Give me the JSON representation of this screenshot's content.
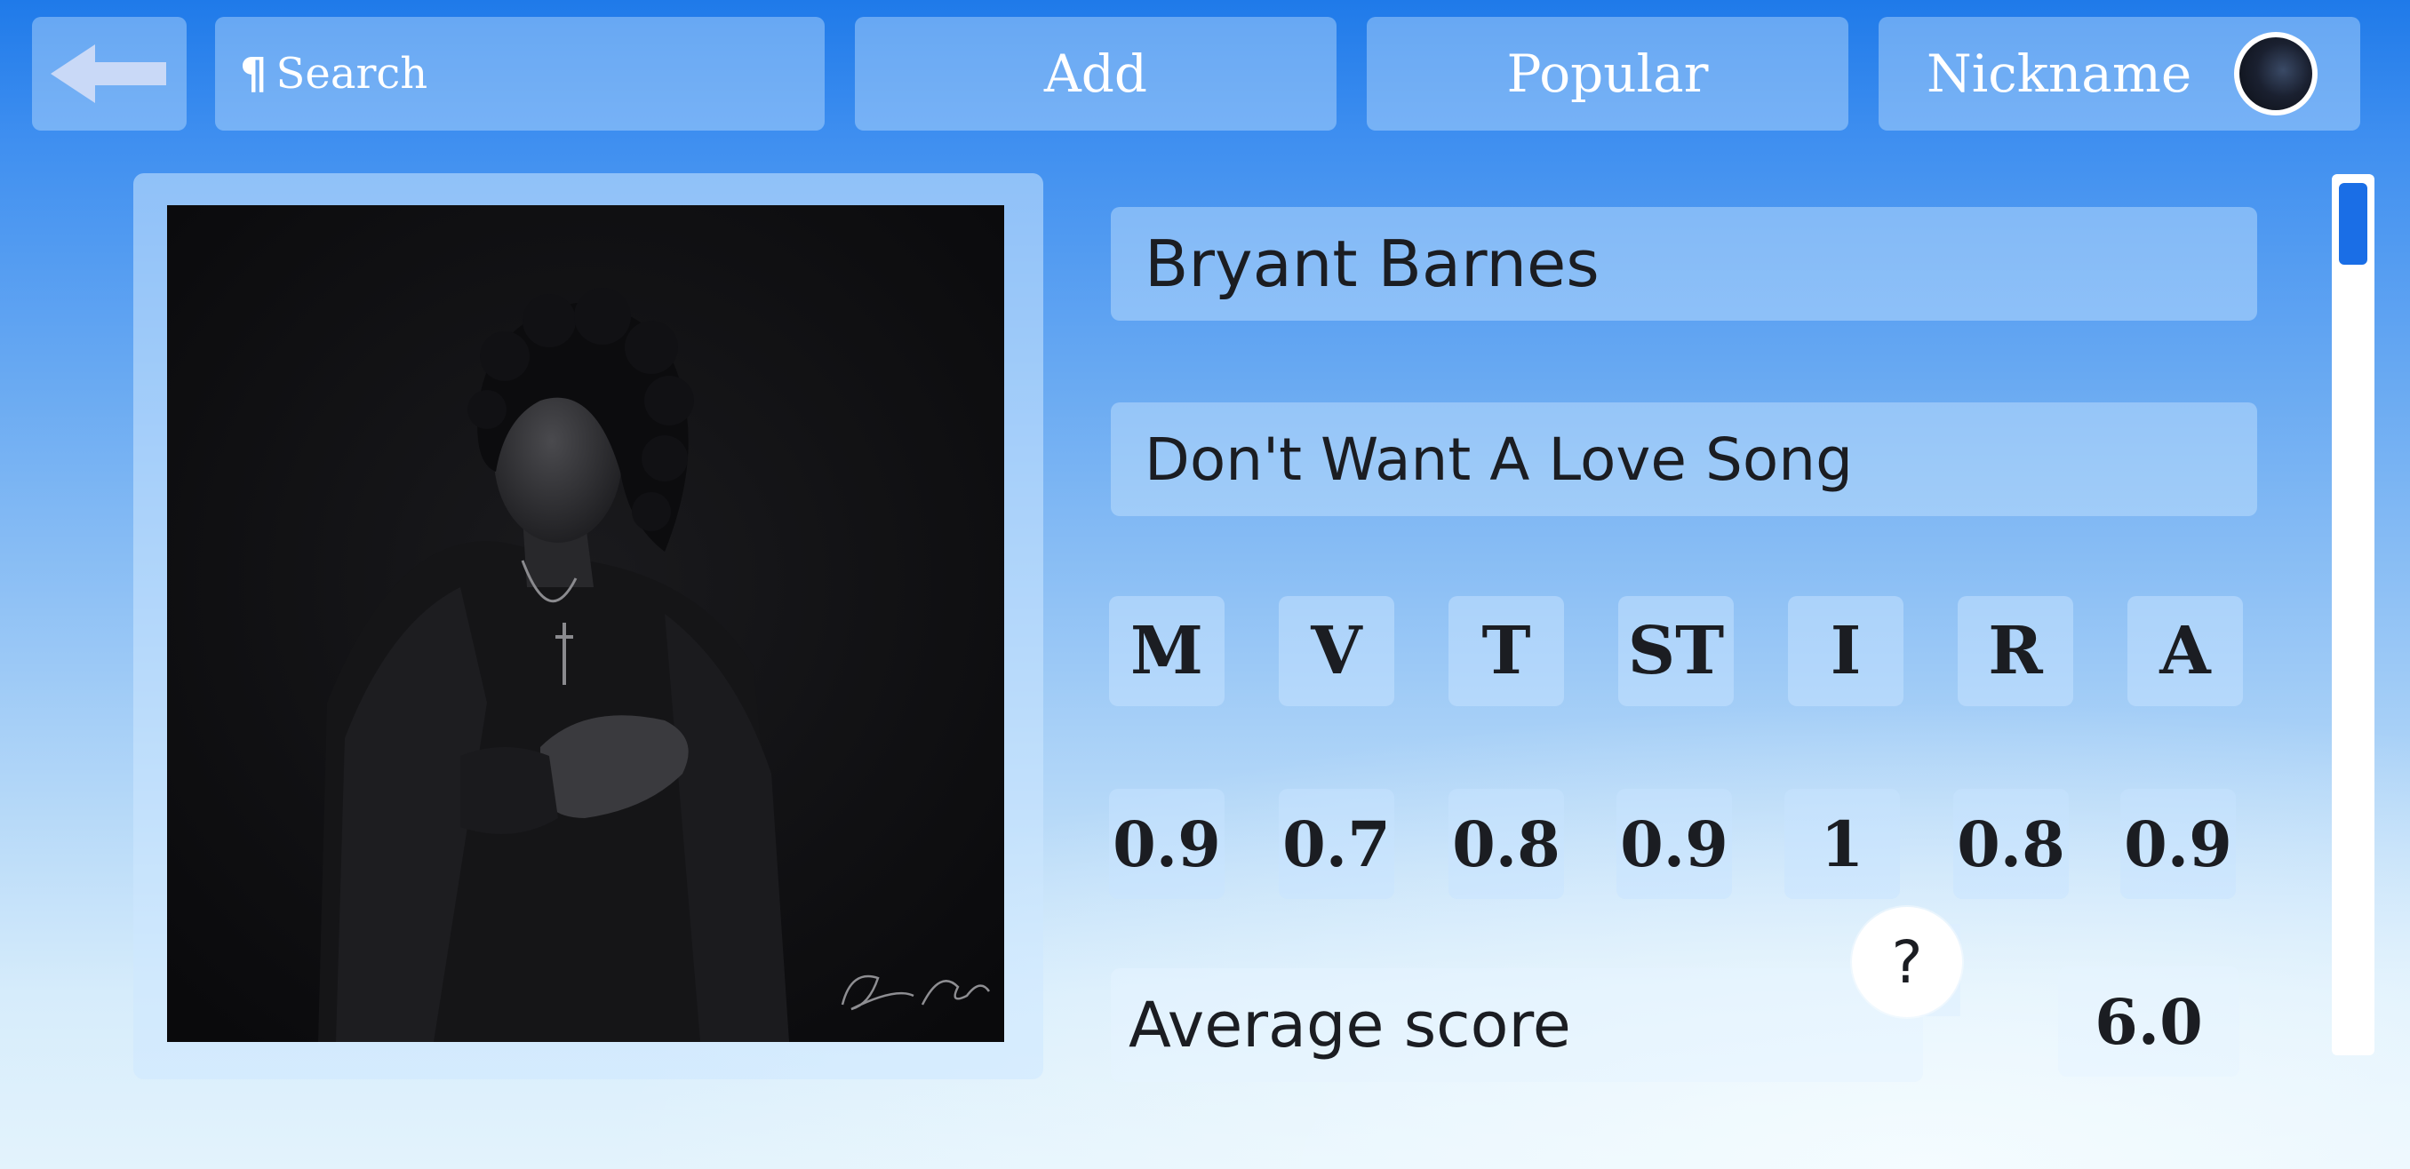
{
  "header": {
    "search_label": "Search",
    "add_label": "Add",
    "popular_label": "Popular",
    "nickname_label": "Nickname"
  },
  "track": {
    "artist": "Bryant Barnes",
    "title": "Don't Want A Love Song"
  },
  "criteria": [
    {
      "label": "M",
      "value": "0.9"
    },
    {
      "label": "V",
      "value": "0.7"
    },
    {
      "label": "T",
      "value": "0.8"
    },
    {
      "label": "ST",
      "value": "0.9"
    },
    {
      "label": "I",
      "value": "1"
    },
    {
      "label": "R",
      "value": "0.8"
    },
    {
      "label": "A",
      "value": "0.9"
    }
  ],
  "average": {
    "label": "Average score",
    "value": "6.0",
    "help_label": "?"
  },
  "colors": {
    "accent": "#1a6ee6",
    "text": "#1b1d22"
  },
  "icons": {
    "back": "arrow-left-icon",
    "search": "pilcrow-icon",
    "help": "question-icon"
  }
}
